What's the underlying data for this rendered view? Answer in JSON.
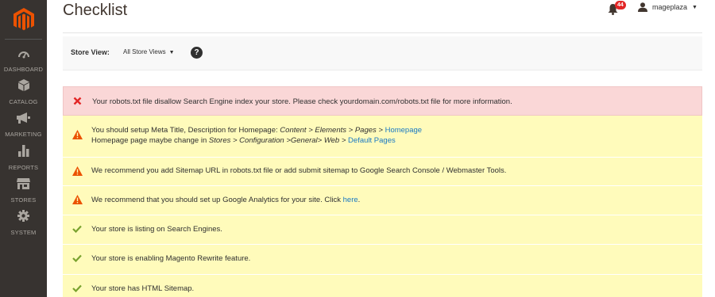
{
  "header": {
    "title": "Checklist",
    "notifications_count": "44",
    "username": "mageplaza"
  },
  "sidebar": {
    "items": [
      {
        "label": "DASHBOARD",
        "icon": "dashboard-icon"
      },
      {
        "label": "CATALOG",
        "icon": "catalog-icon"
      },
      {
        "label": "MARKETING",
        "icon": "marketing-icon"
      },
      {
        "label": "REPORTS",
        "icon": "reports-icon"
      },
      {
        "label": "STORES",
        "icon": "stores-icon"
      },
      {
        "label": "SYSTEM",
        "icon": "system-icon"
      }
    ]
  },
  "store_view": {
    "label": "Store View:",
    "selected": "All Store Views",
    "help": "?"
  },
  "messages": {
    "m1": {
      "type": "error",
      "text": "Your robots.txt file disallow Search Engine index your store. Please check yourdomain.com/robots.txt file for more information."
    },
    "m2": {
      "type": "warning",
      "l1_pre": "You should setup Meta Title, Description for Homepage: ",
      "l1_path": "Content > Elements > Pages > ",
      "l1_link": "Homepage",
      "l2_pre": "Homepage page maybe change in ",
      "l2_path": "Stores > Configuration >General> Web > ",
      "l2_link": "Default Pages"
    },
    "m3": {
      "type": "warning",
      "text": "We recommend you add Sitemap URL in robots.txt file or add submit sitemap to Google Search Console / Webmaster Tools."
    },
    "m4": {
      "type": "warning",
      "pre": "We recommend that you should set up Google Analytics for your site. Click ",
      "link": "here",
      "post": "."
    },
    "m5": {
      "type": "success",
      "text": "Your store is listing on Search Engines."
    },
    "m6": {
      "type": "success",
      "text": "Your store is enabling Magento Rewrite feature."
    },
    "m7": {
      "type": "success",
      "text": "Your store has HTML Sitemap."
    }
  },
  "colors": {
    "sidebar_bg": "#373330",
    "brand_orange": "#eb5202",
    "error_bg": "#fad7d7",
    "warning_bg": "#fffbbb",
    "link": "#1979c3",
    "error_icon": "#e22626",
    "warning_icon": "#eb5202",
    "success_icon": "#79a22e"
  }
}
